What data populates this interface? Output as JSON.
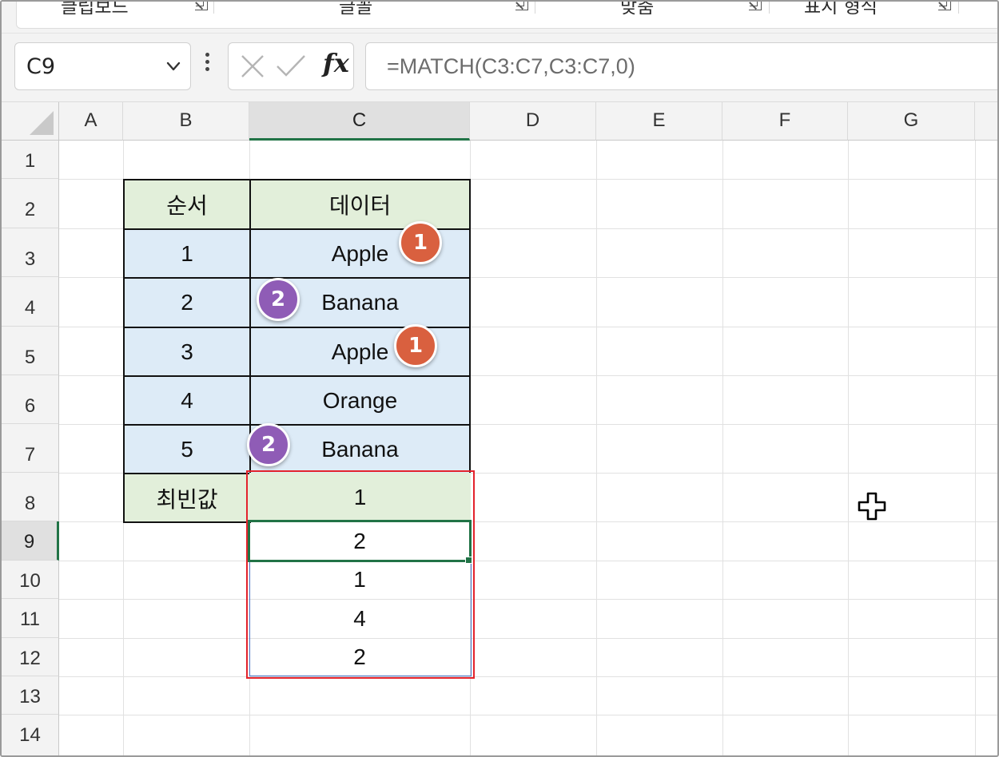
{
  "ribbon": {
    "groups": [
      {
        "label": "클립보드"
      },
      {
        "label": "글꼴"
      },
      {
        "label": "맞춤"
      },
      {
        "label": "표시 형식"
      }
    ]
  },
  "formula_bar": {
    "name_box": "C9",
    "fx_label": "fx",
    "formula": "=MATCH(C3:C7,C3:C7,0)"
  },
  "columns": [
    "A",
    "B",
    "C",
    "D",
    "E",
    "F",
    "G"
  ],
  "active_column": "C",
  "rows": [
    "1",
    "2",
    "3",
    "4",
    "5",
    "6",
    "7",
    "8",
    "9",
    "10",
    "11",
    "12",
    "13",
    "14"
  ],
  "active_row": "9",
  "table": {
    "header": {
      "order": "순서",
      "data": "데이터"
    },
    "rows": [
      {
        "order": "1",
        "data": "Apple"
      },
      {
        "order": "2",
        "data": "Banana"
      },
      {
        "order": "3",
        "data": "Apple"
      },
      {
        "order": "4",
        "data": "Orange"
      },
      {
        "order": "5",
        "data": "Banana"
      }
    ],
    "mode_label": "최빈값",
    "mode_value": "1"
  },
  "results": [
    "2",
    "1",
    "4",
    "2"
  ],
  "badges": [
    {
      "text": "1",
      "color": "#d9603f"
    },
    {
      "text": "2",
      "color": "#8f5cb6"
    },
    {
      "text": "1",
      "color": "#d9603f"
    },
    {
      "text": "2",
      "color": "#8f5cb6"
    }
  ],
  "colors": {
    "header_fill": "#e2efda",
    "data_fill": "#ddebf7",
    "selection_red": "#e3232c",
    "excel_green": "#217346"
  },
  "icons": {
    "cursor": "plus-cursor-icon",
    "cancel": "cancel-x-icon",
    "enter": "enter-check-icon",
    "dropdown": "chevron-down-icon"
  }
}
